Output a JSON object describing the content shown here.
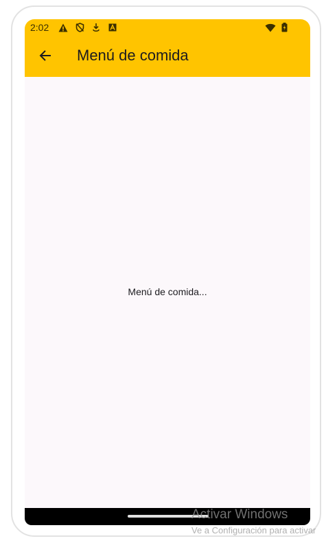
{
  "status_bar": {
    "time": "2:02",
    "left_icons": [
      "warning-icon",
      "shield-off-icon",
      "download-icon",
      "a-box-icon"
    ],
    "right_icons": [
      "wifi-icon",
      "battery-icon"
    ]
  },
  "app_bar": {
    "back_icon": "arrow-left-icon",
    "title": "Menú de comida",
    "color": "#ffc400"
  },
  "body": {
    "message": "Menú de comida..."
  },
  "watermark": {
    "title": "Activar Windows",
    "subtitle": "Ve a Configuración para activar"
  }
}
